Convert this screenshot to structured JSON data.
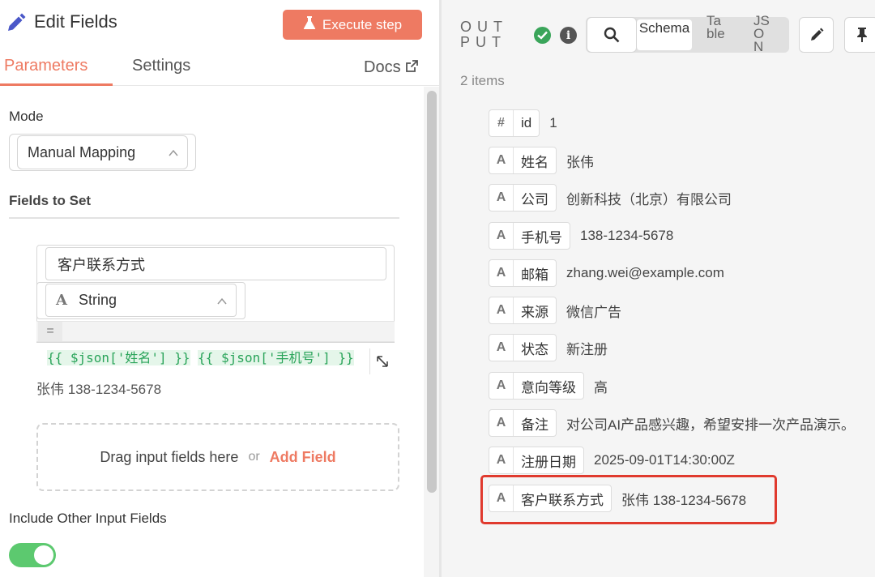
{
  "editor": {
    "title": "Edit Fields",
    "execute_label": "Execute step",
    "tabs": [
      {
        "label": "Parameters",
        "active": true
      },
      {
        "label": "Settings",
        "active": false
      }
    ],
    "docs_label": "Docs",
    "mode_label": "Mode",
    "mode_value": "Manual Mapping",
    "fields_to_set_label": "Fields to Set",
    "field": {
      "name": "客户联系方式",
      "type_icon": "A",
      "type": "String",
      "equals": "=",
      "expr_part1": "{{ $json['姓名'] }}",
      "expr_part2": "{{ $json['手机号'] }}",
      "preview": "张伟 138-1234-5678"
    },
    "drop_text": "Drag input fields here",
    "drop_or": "or",
    "add_field_label": "Add Field",
    "include_label": "Include Other Input Fields",
    "include_enabled": true
  },
  "output": {
    "title": "OUTPUT",
    "views": [
      "Schema",
      "Table",
      "JSON"
    ],
    "active_view": "Schema",
    "items_count": "2 items",
    "rows": [
      {
        "type_icon": "#",
        "key": "id",
        "value": "1"
      },
      {
        "type_icon": "A",
        "key": "姓名",
        "value": "张伟"
      },
      {
        "type_icon": "A",
        "key": "公司",
        "value": "创新科技（北京）有限公司"
      },
      {
        "type_icon": "A",
        "key": "手机号",
        "value": "138-1234-5678"
      },
      {
        "type_icon": "A",
        "key": "邮箱",
        "value": "zhang.wei@example.com"
      },
      {
        "type_icon": "A",
        "key": "来源",
        "value": "微信广告"
      },
      {
        "type_icon": "A",
        "key": "状态",
        "value": "新注册"
      },
      {
        "type_icon": "A",
        "key": "意向等级",
        "value": "高"
      },
      {
        "type_icon": "A",
        "key": "备注",
        "value": "对公司AI产品感兴趣，希望安排一次产品演示。"
      },
      {
        "type_icon": "A",
        "key": "注册日期",
        "value": "2025-09-01T14:30:00Z"
      },
      {
        "type_icon": "A",
        "key": "客户联系方式",
        "value": "张伟 138-1234-5678"
      }
    ]
  },
  "colors": {
    "accent": "#ee7a62",
    "success": "#3aa55a",
    "toggle_on": "#5cc96f",
    "expression": "#2aa45a",
    "highlight": "#e03a2e"
  }
}
